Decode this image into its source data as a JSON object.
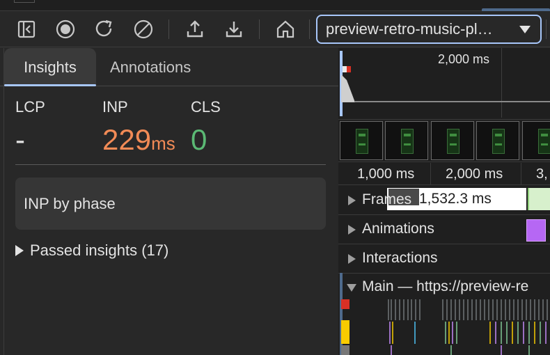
{
  "toolbar": {
    "buttons": [
      {
        "name": "toggle-sidebar-icon"
      },
      {
        "name": "record-icon"
      },
      {
        "name": "reload-record-icon"
      },
      {
        "name": "clear-icon"
      },
      {
        "name": "upload-icon"
      },
      {
        "name": "download-icon"
      },
      {
        "name": "home-icon"
      }
    ],
    "url_select": "preview-retro-music-pl…"
  },
  "left_panel": {
    "tabs": [
      "Insights",
      "Annotations"
    ],
    "active_tab": "Insights",
    "metrics": {
      "lcp": {
        "label": "LCP",
        "value": "-"
      },
      "inp": {
        "label": "INP",
        "value": "229",
        "unit": "ms",
        "color": "#f28b56"
      },
      "cls": {
        "label": "CLS",
        "value": "0",
        "color": "#5bb974"
      }
    },
    "phase_card": "INP by phase",
    "passed_insights": "Passed insights (17)"
  },
  "timeline": {
    "overview_label": "2,000 ms",
    "ruler": [
      "1,000 ms",
      "2,000 ms",
      "3,"
    ],
    "tracks": {
      "frames": {
        "label": "Frames",
        "time": "1,532.3 ms"
      },
      "animations": {
        "label": "Animations"
      },
      "interactions": {
        "label": "Interactions"
      },
      "main": {
        "label": "Main — https://preview-re"
      }
    }
  }
}
